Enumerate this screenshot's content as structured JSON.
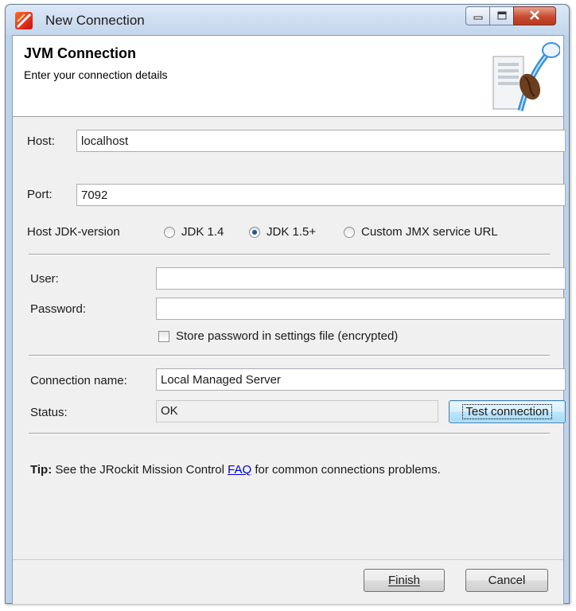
{
  "window": {
    "title": "New Connection",
    "controls": [
      "minimize-icon",
      "maximize-icon",
      "close-icon"
    ]
  },
  "banner": {
    "title": "JVM Connection",
    "subtitle": "Enter your connection details"
  },
  "connection": {
    "host_label": "Host:",
    "host_value": "localhost",
    "port_label": "Port:",
    "port_value": "7092",
    "jdk_label": "Host JDK-version",
    "jdk_options": [
      {
        "label": "JDK 1.4",
        "selected": false
      },
      {
        "label": "JDK 1.5+",
        "selected": true
      },
      {
        "label": "Custom JMX service URL",
        "selected": false
      }
    ]
  },
  "credentials": {
    "user_label": "User:",
    "user_value": "",
    "password_label": "Password:",
    "password_value": "",
    "store_password_label": "Store password in settings file (encrypted)",
    "store_password_checked": false
  },
  "status_section": {
    "name_label": "Connection name:",
    "name_value": "Local Managed Server",
    "status_label": "Status:",
    "status_value": "OK",
    "test_button": "Test connection"
  },
  "tip": {
    "prefix": "Tip:",
    "text_before": " See the JRockit Mission Control ",
    "link": "FAQ",
    "text_after": " for common connections problems."
  },
  "footer": {
    "finish": "Finish",
    "cancel": "Cancel"
  },
  "colors": {
    "title_bar": "#c3d6ec",
    "dialog_bg": "#f0f0f0",
    "link": "#0000cc",
    "radio_dot": "#1d5b95"
  }
}
